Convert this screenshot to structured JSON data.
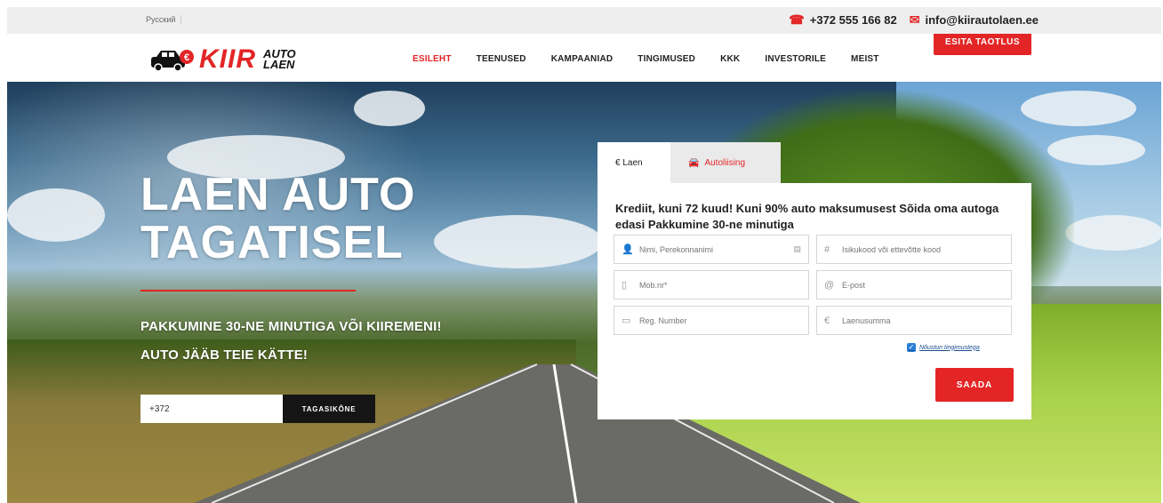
{
  "topbar": {
    "language": "Русский",
    "phone": "+372 555 166 82",
    "email": "info@kiirautolaen.ee"
  },
  "logo": {
    "main": "KIIR",
    "line1": "AUTO",
    "line2": "LAEN"
  },
  "nav": {
    "items": [
      {
        "label": "ESILEHT",
        "active": true
      },
      {
        "label": "TEENUSED",
        "active": false
      },
      {
        "label": "KAMPAANIAD",
        "active": false
      },
      {
        "label": "TINGIMUSED",
        "active": false
      },
      {
        "label": "KKK",
        "active": false
      },
      {
        "label": "INVESTORILE",
        "active": false
      },
      {
        "label": "MEIST",
        "active": false
      }
    ],
    "apply_button": "ESITA TAOTLUS"
  },
  "hero": {
    "title_line1": "LAEN AUTO",
    "title_line2": "TAGATISEL",
    "sub_line1": "PAKKUMINE 30-NE MINUTIGA VÕI KIIREMENI!",
    "sub_line2": "AUTO JÄÄB TEIE KÄTTE!",
    "phone_value": "+372",
    "callback_button": "TAGASIKÕNE"
  },
  "form": {
    "tabs": [
      {
        "label": "€ Laen",
        "active": true
      },
      {
        "label": "Autoliising",
        "active": false
      }
    ],
    "title": "Krediit, kuni 72 kuud! Kuni 90% auto maksumusest Sõida oma autoga edasi Pakkumine 30-ne minutiga",
    "fields": {
      "name": "Nimi, Perekonnanimi",
      "id_code": "Isikukood või ettevõtte kood",
      "mobile": "Mob.nr*",
      "email": "E-post",
      "reg_number": "Reg. Number",
      "amount": "Laenusumma"
    },
    "terms_label": "Nõustun tingimustega",
    "terms_checked": true,
    "submit": "SAADA"
  },
  "colors": {
    "accent": "#e32526",
    "dark": "#151515"
  }
}
